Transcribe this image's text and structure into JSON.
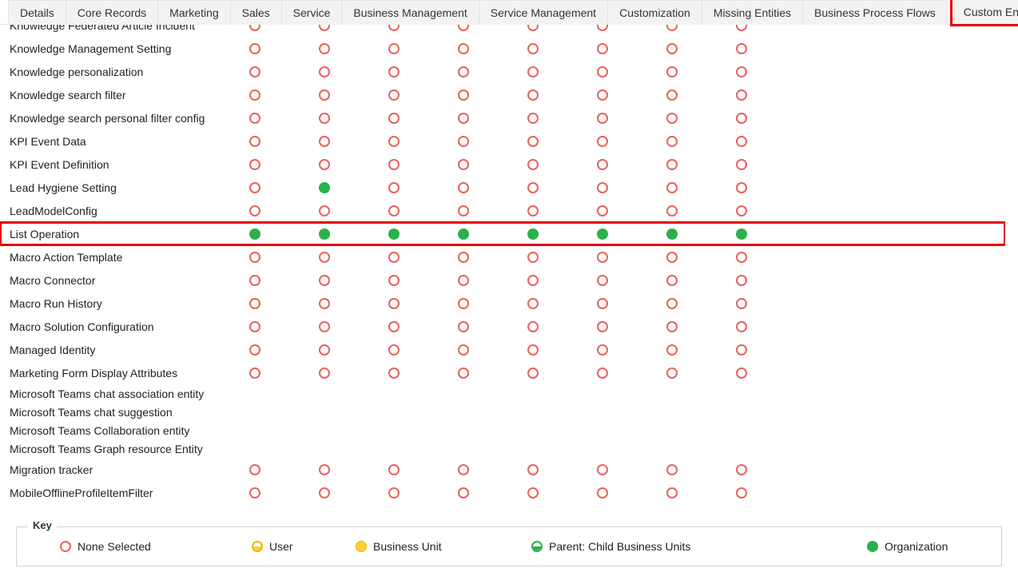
{
  "tabs": [
    {
      "label": "Details",
      "highlighted": false
    },
    {
      "label": "Core Records",
      "highlighted": false
    },
    {
      "label": "Marketing",
      "highlighted": false
    },
    {
      "label": "Sales",
      "highlighted": false
    },
    {
      "label": "Service",
      "highlighted": false
    },
    {
      "label": "Business Management",
      "highlighted": false
    },
    {
      "label": "Service Management",
      "highlighted": false
    },
    {
      "label": "Customization",
      "highlighted": false
    },
    {
      "label": "Missing Entities",
      "highlighted": false
    },
    {
      "label": "Business Process Flows",
      "highlighted": false
    },
    {
      "label": "Custom Entities",
      "highlighted": true
    }
  ],
  "columns_count": 8,
  "rows": [
    {
      "label": "Knowledge Federated Article Incident",
      "cells": [
        "empty",
        "empty",
        "empty",
        "empty",
        "empty",
        "empty",
        "empty",
        "empty"
      ],
      "highlighted": false
    },
    {
      "label": "Knowledge Management Setting",
      "cells": [
        "empty",
        "empty",
        "empty",
        "empty",
        "empty",
        "empty",
        "empty",
        "empty"
      ],
      "highlighted": false
    },
    {
      "label": "Knowledge personalization",
      "cells": [
        "empty",
        "empty",
        "empty",
        "empty",
        "empty",
        "empty",
        "empty",
        "empty"
      ],
      "highlighted": false
    },
    {
      "label": "Knowledge search filter",
      "cells": [
        "empty",
        "empty",
        "empty",
        "empty",
        "empty",
        "empty",
        "empty",
        "empty"
      ],
      "highlighted": false
    },
    {
      "label": "Knowledge search personal filter config",
      "cells": [
        "empty",
        "empty",
        "empty",
        "empty",
        "empty",
        "empty",
        "empty",
        "empty"
      ],
      "highlighted": false
    },
    {
      "label": "KPI Event Data",
      "cells": [
        "empty",
        "empty",
        "empty",
        "empty",
        "empty",
        "empty",
        "empty",
        "empty"
      ],
      "highlighted": false
    },
    {
      "label": "KPI Event Definition",
      "cells": [
        "empty",
        "empty",
        "empty",
        "empty",
        "empty",
        "empty",
        "empty",
        "empty"
      ],
      "highlighted": false
    },
    {
      "label": "Lead Hygiene Setting",
      "cells": [
        "empty",
        "filled-green",
        "empty",
        "empty",
        "empty",
        "empty",
        "empty",
        "empty"
      ],
      "highlighted": false
    },
    {
      "label": "LeadModelConfig",
      "cells": [
        "empty",
        "empty",
        "empty",
        "empty",
        "empty",
        "empty",
        "empty",
        "empty"
      ],
      "highlighted": false
    },
    {
      "label": "List Operation",
      "cells": [
        "filled-green",
        "filled-green",
        "filled-green",
        "filled-green",
        "filled-green",
        "filled-green",
        "filled-green",
        "filled-green"
      ],
      "highlighted": true
    },
    {
      "label": "Macro Action Template",
      "cells": [
        "empty",
        "empty",
        "empty",
        "empty",
        "empty",
        "empty",
        "empty",
        "empty"
      ],
      "highlighted": false
    },
    {
      "label": "Macro Connector",
      "cells": [
        "empty",
        "empty",
        "empty",
        "empty",
        "empty",
        "empty",
        "empty",
        "empty"
      ],
      "highlighted": false
    },
    {
      "label": "Macro Run History",
      "cells": [
        "empty",
        "empty",
        "empty",
        "empty",
        "empty",
        "empty",
        "empty",
        "empty"
      ],
      "highlighted": false
    },
    {
      "label": "Macro Solution Configuration",
      "cells": [
        "empty",
        "empty",
        "empty",
        "empty",
        "empty",
        "empty",
        "empty",
        "empty"
      ],
      "highlighted": false
    },
    {
      "label": "Managed Identity",
      "cells": [
        "empty",
        "empty",
        "empty",
        "empty",
        "empty",
        "empty",
        "empty",
        "empty"
      ],
      "highlighted": false
    },
    {
      "label": "Marketing Form Display Attributes",
      "cells": [
        "empty",
        "empty",
        "empty",
        "empty",
        "empty",
        "empty",
        "empty",
        "empty"
      ],
      "highlighted": false
    },
    {
      "label": "Microsoft Teams chat association entity",
      "cells": [],
      "highlighted": false
    },
    {
      "label": "Microsoft Teams chat suggestion",
      "cells": [],
      "highlighted": false
    },
    {
      "label": "Microsoft Teams Collaboration entity",
      "cells": [],
      "highlighted": false
    },
    {
      "label": "Microsoft Teams Graph resource Entity",
      "cells": [],
      "highlighted": false
    },
    {
      "label": "Migration tracker",
      "cells": [
        "empty",
        "empty",
        "empty",
        "empty",
        "empty",
        "empty",
        "empty",
        "empty"
      ],
      "highlighted": false
    },
    {
      "label": "MobileOfflineProfileItemFilter",
      "cells": [
        "empty",
        "empty",
        "empty",
        "empty",
        "empty",
        "empty",
        "empty",
        "empty"
      ],
      "highlighted": false
    }
  ],
  "legend": {
    "title": "Key",
    "items": [
      {
        "label": "None Selected",
        "type": "empty"
      },
      {
        "label": "User",
        "type": "half-yellow"
      },
      {
        "label": "Business Unit",
        "type": "filled-yellow"
      },
      {
        "label": "Parent: Child Business Units",
        "type": "half-green"
      },
      {
        "label": "Organization",
        "type": "filled-green"
      }
    ]
  }
}
